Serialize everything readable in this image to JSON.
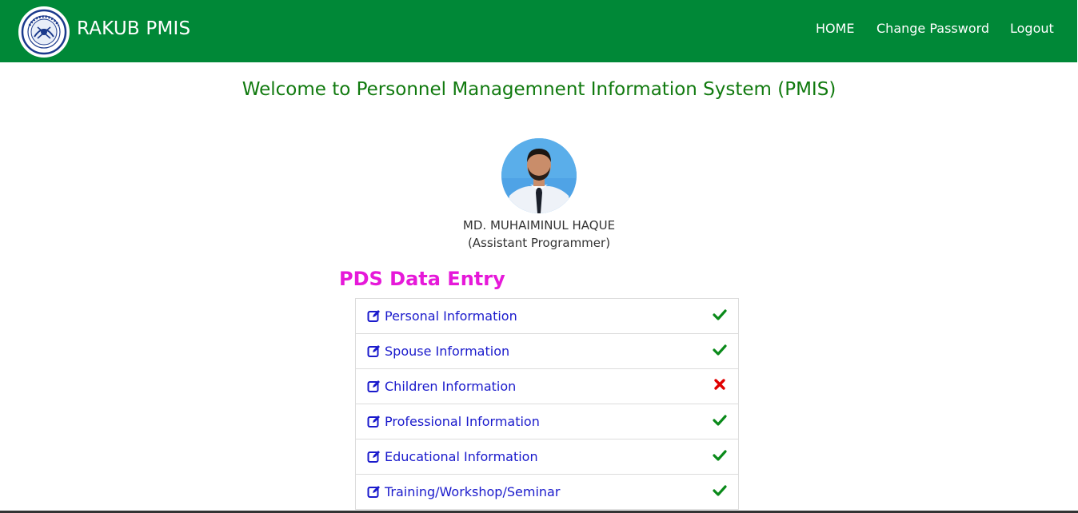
{
  "header": {
    "brand": "RAKUB PMIS",
    "logo_icon": "rakub-bank-seal-logo",
    "nav": [
      {
        "label": "HOME"
      },
      {
        "label": "Change Password"
      },
      {
        "label": "Logout"
      }
    ],
    "background": "#008837"
  },
  "main": {
    "welcome": "Welcome to Personnel Managemnent Information System (PMIS)",
    "user": {
      "name": "MD. MUHAIMINUL HAQUE",
      "title": "(Assistant Programmer)"
    },
    "section_title": "PDS Data Entry",
    "entries": [
      {
        "label": "Personal Information",
        "status": "complete"
      },
      {
        "label": "Spouse Information",
        "status": "complete"
      },
      {
        "label": "Children Information",
        "status": "incomplete"
      },
      {
        "label": "Professional Information",
        "status": "complete"
      },
      {
        "label": "Educational Information",
        "status": "complete"
      },
      {
        "label": "Training/Workshop/Seminar",
        "status": "complete"
      }
    ]
  },
  "colors": {
    "accent_green": "#008837",
    "welcome_text": "#117a0f",
    "section_title": "#e619d9",
    "link": "#1a1acc",
    "check": "#0a8a1a",
    "cross": "#e00000"
  }
}
